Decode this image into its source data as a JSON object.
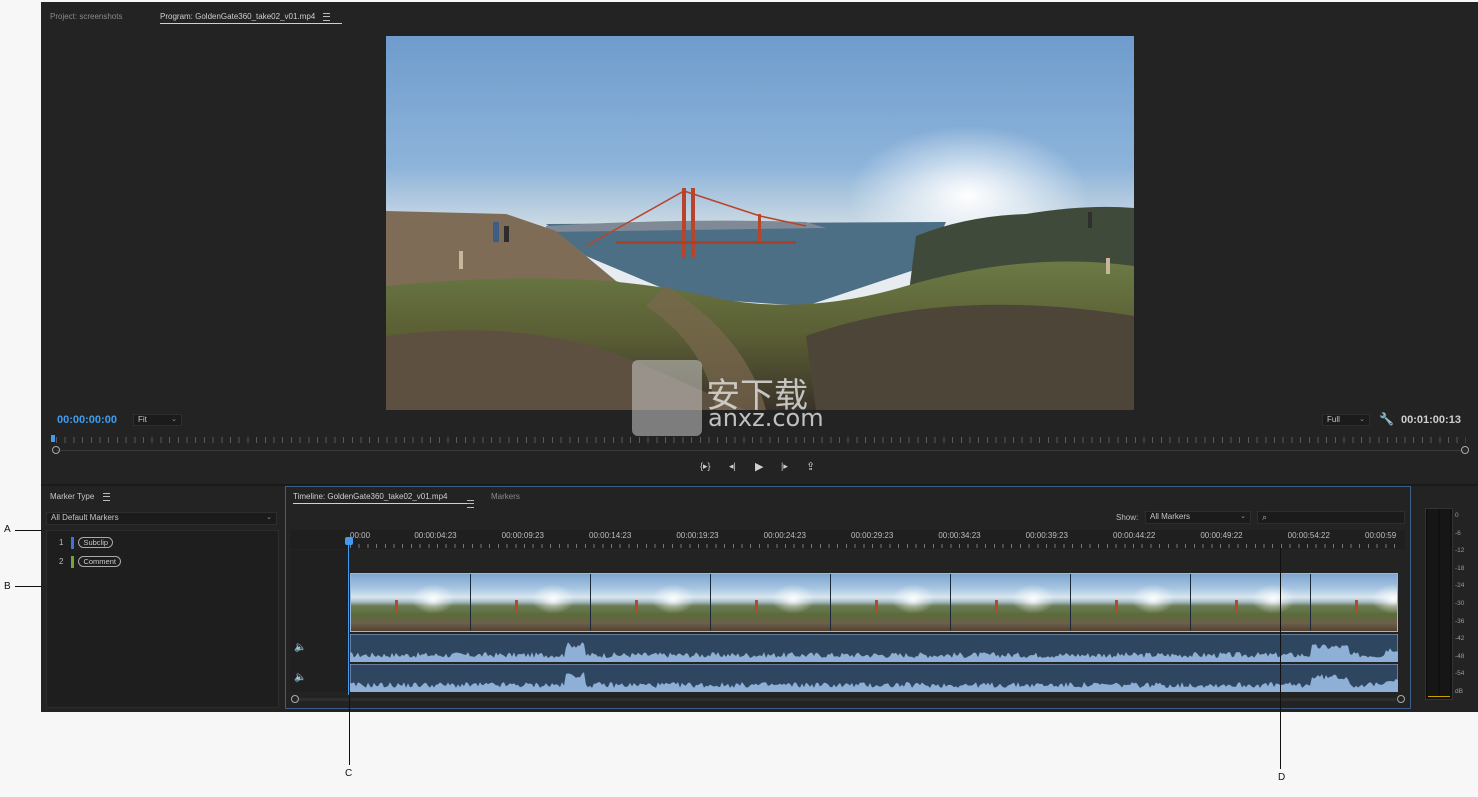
{
  "top_tabs": {
    "project": "Project: screenshots",
    "program": "Program: GoldenGate360_take02_v01.mp4"
  },
  "monitor": {
    "current_timecode": "00:00:00:00",
    "zoom_select": "Fit",
    "quality_select": "Full",
    "duration_timecode": "00:01:00:13",
    "watermark_text": "安下载",
    "watermark_sub": "anxz.com"
  },
  "markers_panel": {
    "title": "Marker Type",
    "filter_select": "All Default Markers",
    "items": [
      {
        "index": "1",
        "label": "Subclip",
        "color": "#3e73d8"
      },
      {
        "index": "2",
        "label": "Comment",
        "color": "#7aa03c"
      }
    ]
  },
  "timeline": {
    "tab_active": "Timeline: GoldenGate360_take02_v01.mp4",
    "tab_markers": "Markers",
    "show_label": "Show:",
    "show_select": "All Markers",
    "search_placeholder": "",
    "ruler_labels": [
      "00:00",
      "00:00:04:23",
      "00:00:09:23",
      "00:00:14:23",
      "00:00:19:23",
      "00:00:24:23",
      "00:00:29:23",
      "00:00:34:23",
      "00:00:39:23",
      "00:00:44:22",
      "00:00:49:22",
      "00:00:54:22",
      "00:00:59"
    ]
  },
  "vu_meter": {
    "labels": [
      "0",
      "-6",
      "-12",
      "-18",
      "-24",
      "-30",
      "-36",
      "-42",
      "-48",
      "-54",
      "dB"
    ]
  },
  "callouts": {
    "a": "A",
    "b": "B",
    "c": "C",
    "d": "D"
  },
  "colors": {
    "accent_blue": "#3f9cf0",
    "panel_bg": "#232323"
  }
}
